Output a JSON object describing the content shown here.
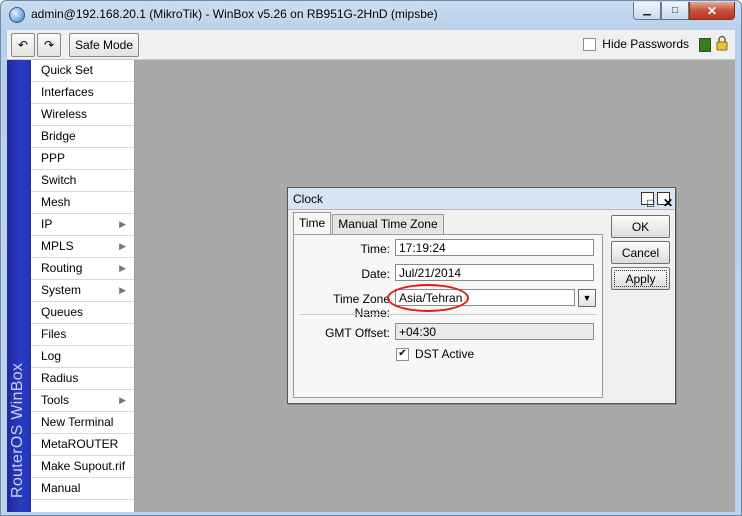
{
  "window": {
    "title": "admin@192.168.20.1 (MikroTik) - WinBox v5.26 on RB951G-2HnD (mipsbe)",
    "minimize_glyph": "▁",
    "maximize_glyph": "□",
    "close_glyph": "✕"
  },
  "toolbar": {
    "undo_glyph": "↶",
    "redo_glyph": "↷",
    "safe_mode_label": "Safe Mode",
    "hide_passwords_label": "Hide Passwords",
    "hide_passwords_checked": false,
    "status_color": "#3a7a22"
  },
  "sidebar": {
    "brand": "RouterOS WinBox",
    "items": [
      {
        "label": "Quick Set",
        "submenu": false
      },
      {
        "label": "Interfaces",
        "submenu": false
      },
      {
        "label": "Wireless",
        "submenu": false
      },
      {
        "label": "Bridge",
        "submenu": false
      },
      {
        "label": "PPP",
        "submenu": false
      },
      {
        "label": "Switch",
        "submenu": false
      },
      {
        "label": "Mesh",
        "submenu": false
      },
      {
        "label": "IP",
        "submenu": true
      },
      {
        "label": "MPLS",
        "submenu": true
      },
      {
        "label": "Routing",
        "submenu": true
      },
      {
        "label": "System",
        "submenu": true
      },
      {
        "label": "Queues",
        "submenu": false
      },
      {
        "label": "Files",
        "submenu": false
      },
      {
        "label": "Log",
        "submenu": false
      },
      {
        "label": "Radius",
        "submenu": false
      },
      {
        "label": "Tools",
        "submenu": true
      },
      {
        "label": "New Terminal",
        "submenu": false
      },
      {
        "label": "MetaROUTER",
        "submenu": false
      },
      {
        "label": "Make Supout.rif",
        "submenu": false
      },
      {
        "label": "Manual",
        "submenu": false
      }
    ],
    "submenu_glyph": "▶"
  },
  "clock_dialog": {
    "title": "Clock",
    "tabs": [
      "Time",
      "Manual Time Zone"
    ],
    "active_tab": "Time",
    "time_label": "Time:",
    "time_value": "17:19:24",
    "date_label": "Date:",
    "date_value": "Jul/21/2014",
    "tz_label": "Time Zone Name:",
    "tz_value": "Asia/Tehran",
    "gmt_label": "GMT Offset:",
    "gmt_value": "+04:30",
    "dst_label": "DST Active",
    "dst_checked": true,
    "check_glyph": "✔",
    "dropdown_glyph": "▼",
    "buttons": {
      "ok": "OK",
      "cancel": "Cancel",
      "apply": "Apply"
    },
    "highlight_color": "#e01818"
  }
}
